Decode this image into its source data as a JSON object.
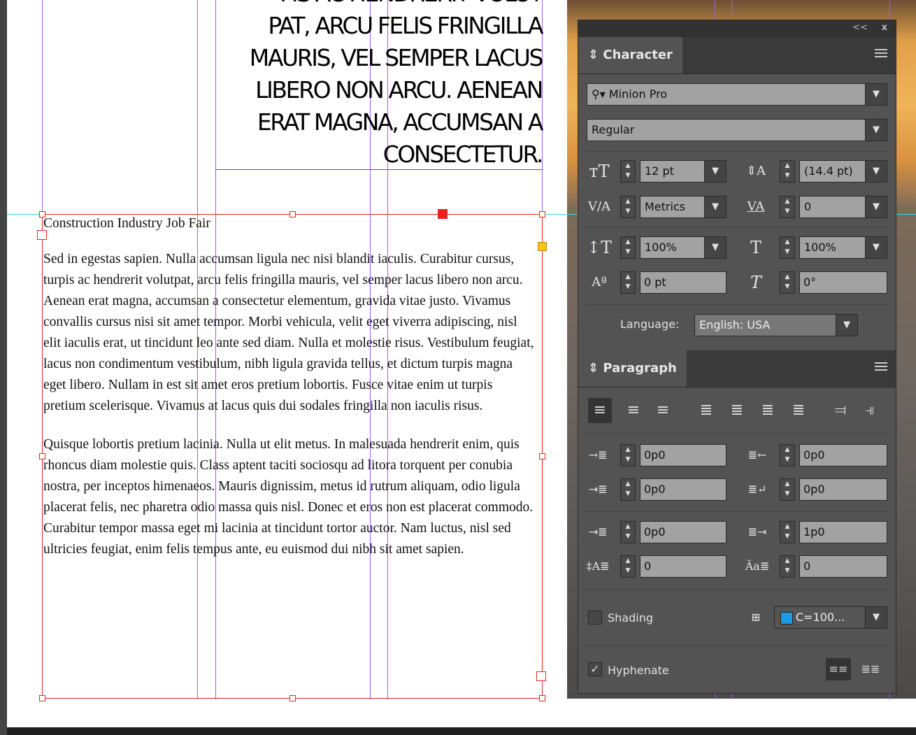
{
  "document": {
    "heading_lines": [
      "FIS AC HENDRERIT VOLUT",
      "PAT, ARCU FELIS FRINGILLA",
      "MAURIS, VEL SEMPER LACUS",
      "LIBERO NON ARCU. AENEAN",
      "ERAT MAGNA, ACCUMSAN A",
      "CONSECTETUR."
    ],
    "title": "Construction Industry Job Fair",
    "paragraph1": "Sed in egestas sapien. Nulla accumsan ligula nec nisi blandit iaculis. Curabitur cursus, turpis ac hendrerit volutpat, arcu felis fringilla mauris, vel semper lacus libero non arcu. Aenean erat magna, accumsan a consectetur elementum, gravida vitae justo. Vivamus convallis cursus nisi sit amet tempor. Morbi vehicula, velit eget viverra adipiscing, nisl elit iaculis erat, ut tincidunt leo ante sed diam. Nulla et molestie risus. Vestibulum feugiat, lacus non condimentum vestibulum, nibh ligula gravida tellus, et dictum turpis magna eget libero. Nullam in est sit amet eros pretium lobortis. Fusce vitae enim ut turpis pretium scelerisque. Vivamus at lacus quis dui sodales fringilla non iaculis risus.",
    "paragraph2": "Quisque lobortis pretium lacinia. Nulla ut elit metus. In malesuada hendrerit enim, quis rhoncus diam molestie quis. Class aptent taciti sociosqu ad litora torquent per conubia nostra, per inceptos himenaeos. Mauris dignissim, metus id rutrum aliquam, odio ligula placerat felis, nec pharetra odio massa quis nisl. Donec et eros non est placerat commodo. Curabitur tempor massa eget mi lacinia at tincidunt tortor auctor. Nam luctus, nisl sed ultricies feugiat, enim felis tempus ante, eu euismod dui nibh sit amet sapien."
  },
  "panel": {
    "collapse_label": "<<",
    "close_label": "x",
    "character": {
      "tab_label": "Character",
      "font_family": "Minion Pro",
      "font_style": "Regular",
      "font_size": "12 pt",
      "leading": "(14.4 pt)",
      "kerning": "Metrics",
      "tracking": "0",
      "vertical_scale": "100%",
      "horizontal_scale": "100%",
      "baseline_shift": "0 pt",
      "skew": "0°",
      "language_label": "Language:",
      "language": "English: USA"
    },
    "paragraph": {
      "tab_label": "Paragraph",
      "left_indent": "0p0",
      "right_indent": "0p0",
      "first_line_indent": "0p0",
      "last_line_indent": "0p0",
      "space_before": "0p0",
      "space_after": "1p0",
      "drop_cap_lines": "0",
      "drop_cap_chars": "0",
      "shading_label": "Shading",
      "shading_color": "C=100...",
      "hyphenate_label": "Hyphenate"
    }
  },
  "colors": {
    "frame": "#e8231e",
    "guide_vertical": "#9b5cf0",
    "guide_horizontal": "#2fd7e6",
    "panel_bg": "#535353",
    "swatch_cyan": "#1a9be6"
  }
}
